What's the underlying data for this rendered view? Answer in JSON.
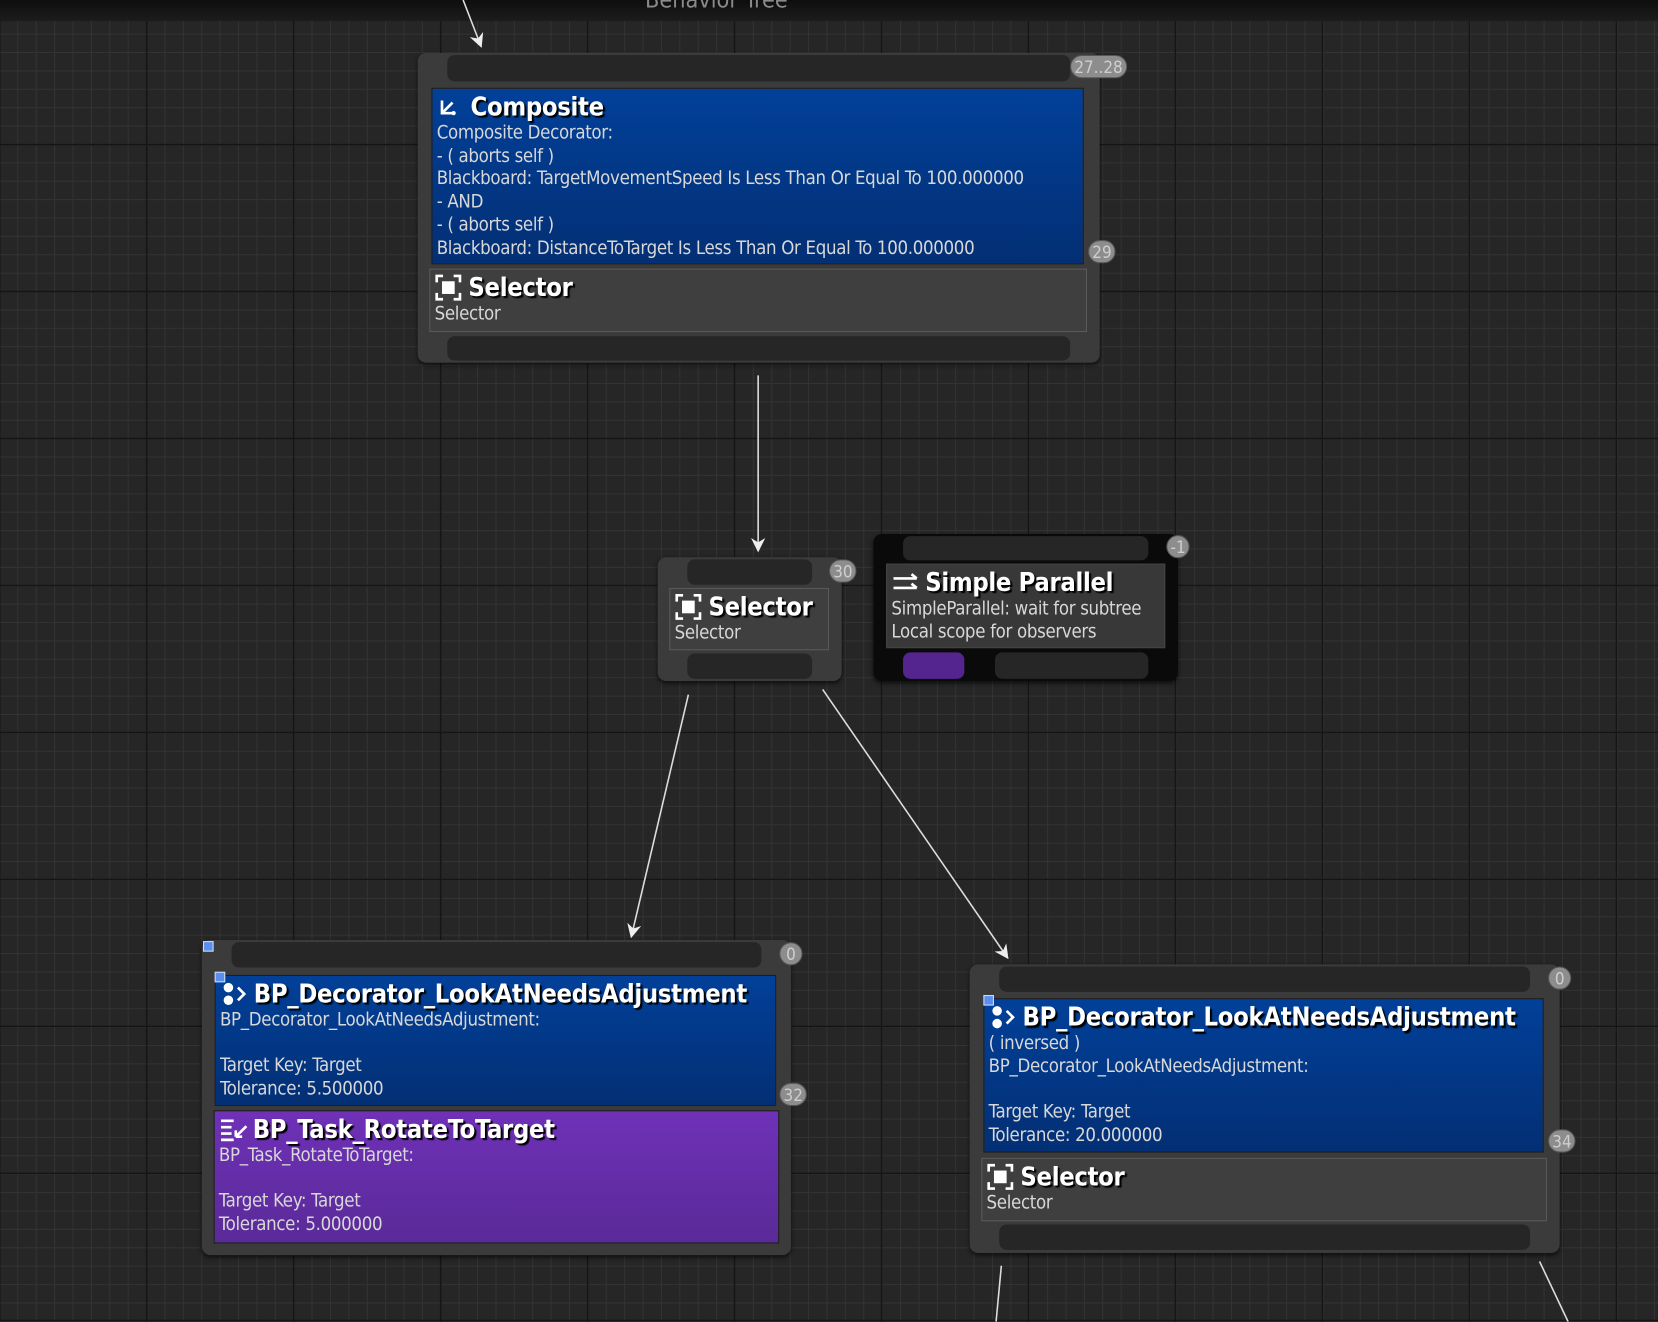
{
  "graph_title": "Behavior Tree",
  "nodes": {
    "composite_selector": {
      "badge_top": "27..28",
      "decorator": {
        "title": "Composite",
        "icon": "composite-arrow-icon",
        "lines": [
          "Composite Decorator:",
          "- ( aborts self )",
          "Blackboard: TargetMovementSpeed Is Less Than Or Equal To 100.000000",
          "- AND",
          "- ( aborts self )",
          "Blackboard: DistanceToTarget Is Less Than Or Equal To 100.000000"
        ],
        "badge": "29"
      },
      "title": "Selector",
      "subtitle": "Selector",
      "icon": "selector-icon"
    },
    "selector_30": {
      "badge": "30",
      "title": "Selector",
      "subtitle": "Selector",
      "icon": "selector-icon"
    },
    "simple_parallel": {
      "badge": "-1",
      "title": "Simple Parallel",
      "icon": "parallel-arrows-icon",
      "lines": [
        "SimpleParallel: wait for subtree",
        "Local scope for observers"
      ]
    },
    "left_branch": {
      "badge_top": "0",
      "decorator": {
        "title": "BP_Decorator_LookAtNeedsAdjustment",
        "icon": "decorator-icon",
        "lines": [
          "BP_Decorator_LookAtNeedsAdjustment:",
          "",
          "Target Key: Target",
          "Tolerance: 5.500000"
        ],
        "badge": "32"
      },
      "task": {
        "title": "BP_Task_RotateToTarget",
        "icon": "task-icon",
        "lines": [
          "BP_Task_RotateToTarget:",
          "",
          "Target Key: Target",
          "Tolerance: 5.000000"
        ]
      }
    },
    "right_branch": {
      "badge_top": "0",
      "decorator": {
        "title": "BP_Decorator_LookAtNeedsAdjustment",
        "icon": "decorator-icon",
        "lines": [
          "( inversed )",
          "BP_Decorator_LookAtNeedsAdjustment:",
          "",
          "Target Key: Target",
          "Tolerance: 20.000000"
        ],
        "badge": "34"
      },
      "title": "Selector",
      "subtitle": "Selector",
      "icon": "selector-icon"
    }
  },
  "colors": {
    "decorator": "#02419a",
    "task": "#6a30b0",
    "composite": "#3f3f3f",
    "background": "#262626"
  }
}
